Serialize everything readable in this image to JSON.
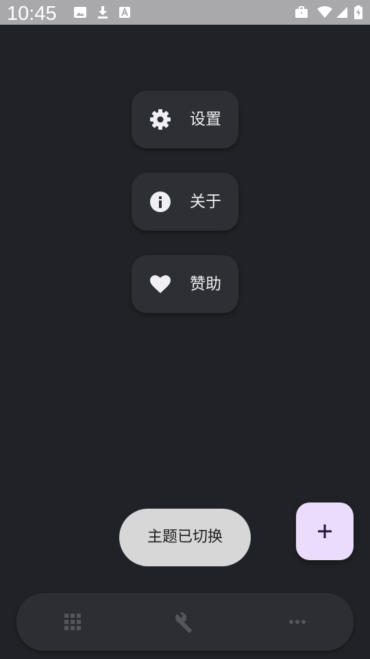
{
  "status_bar": {
    "time": "10:45",
    "icons": [
      "image-icon",
      "download-icon",
      "translate-icon",
      "briefcase-icon",
      "wifi-icon",
      "signal-icon",
      "battery-charging-icon"
    ]
  },
  "menu": {
    "items": [
      {
        "label": "设置",
        "icon": "gear-icon"
      },
      {
        "label": "关于",
        "icon": "info-icon"
      },
      {
        "label": "赞助",
        "icon": "heart-icon"
      }
    ]
  },
  "toast": {
    "text": "主题已切换"
  },
  "fab": {
    "icon": "plus-icon",
    "color": "#ebdcfb"
  },
  "bottom_nav": {
    "items": [
      {
        "icon": "grid-icon"
      },
      {
        "icon": "wrench-icon"
      },
      {
        "icon": "more-horizontal-icon"
      }
    ]
  },
  "colors": {
    "background": "#212227",
    "card": "#2e2f34",
    "status_bar": "#a9a9ab",
    "toast": "#d7d7d7",
    "fab": "#ebdcfb"
  }
}
